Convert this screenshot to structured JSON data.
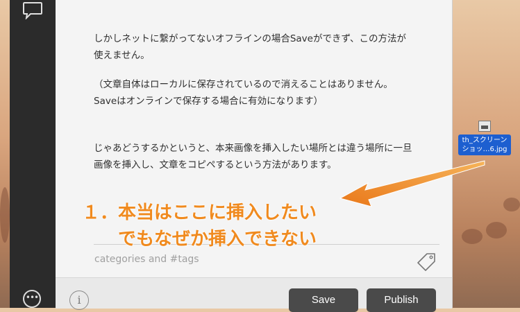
{
  "editor": {
    "paragraphs": [
      "しかしネットに繋がってないオフラインの場合Saveができず、この方法が\n使えません。",
      "（文章自体はローカルに保存されているので消えることはありません。\nSaveはオンラインで保存する場合に有効になります）",
      "じゃあどうするかというと、本来画像を挿入したい場所とは違う場所に一旦\n画像を挿入し、文章をコピペするという方法があります。"
    ],
    "tags_placeholder": "categories and #tags"
  },
  "footer": {
    "info_label": "i",
    "save_label": "Save",
    "publish_label": "Publish"
  },
  "annotation": {
    "line1": "１．本当はここに挿入したい",
    "line2": "でもなぜか挿入できない",
    "color": "#f08a1e"
  },
  "desktop_file": {
    "name_line1": "th_スクリーン",
    "name_line2": "ショッ…6.jpg"
  },
  "sidebar": {
    "more_label": "•••"
  },
  "icons": [
    "chat-bubble-icon",
    "more-icon",
    "info-icon",
    "tag-icon",
    "image-file-icon"
  ]
}
